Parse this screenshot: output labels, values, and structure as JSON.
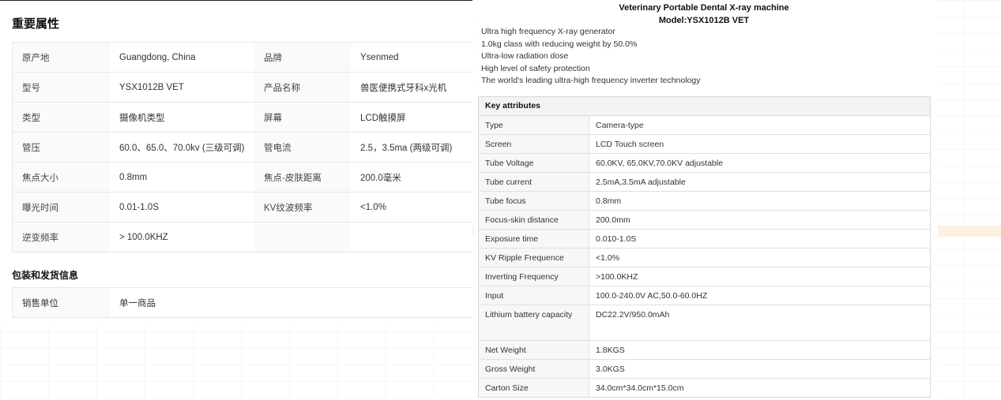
{
  "left": {
    "title": "重要属性",
    "attributes": [
      [
        "原产地",
        "Guangdong, China",
        "品牌",
        "Ysenmed"
      ],
      [
        "型号",
        "YSX1012B VET",
        "产品名称",
        "兽医便携式牙科x光机"
      ],
      [
        "类型",
        "摄像机类型",
        "屏幕",
        "LCD触摸屏"
      ],
      [
        "管压",
        "60.0、65.0、70.0kv (三级可调)",
        "管电流",
        "2.5，3.5ma (两级可调)"
      ],
      [
        "焦点大小",
        "0.8mm",
        "焦点-皮肤距离",
        "200.0毫米"
      ],
      [
        "曝光时间",
        "0.01-1.0S",
        "KV纹波频率",
        "<1.0%"
      ],
      [
        "逆变频率",
        "> 100.0KHZ",
        "",
        ""
      ]
    ],
    "packaging_title": "包装和发货信息",
    "packaging": [
      [
        "销售单位",
        "单一商品"
      ]
    ]
  },
  "right": {
    "title_line1": "Veterinary Portable Dental X-ray machine",
    "title_line2": "Model:YSX1012B VET",
    "features": [
      "Ultra high frequency X-ray generator",
      "1.0kg class with reducing weight by 50.0%",
      "Ultra-low radiation dose",
      "High level of safety protection",
      "The world's leading ultra-high frequency inverter technology"
    ],
    "spec_header": "Key attributes",
    "specs": [
      [
        "Type",
        "Camera-type"
      ],
      [
        "Screen",
        "LCD Touch screen"
      ],
      [
        "Tube Voltage",
        "60.0KV, 65.0KV,70.0KV adjustable"
      ],
      [
        "Tube current",
        "2.5mA,3.5mA adjustable"
      ],
      [
        "Tube focus",
        "0.8mm"
      ],
      [
        "Focus-skin distance",
        "200.0mm"
      ],
      [
        "Exposure time",
        "0.010-1.0S"
      ],
      [
        "KV Ripple Frequence",
        "<1.0%"
      ],
      [
        "Inverting Frequency",
        ">100.0KHZ"
      ],
      [
        "Input",
        "100.0-240.0V AC,50.0-60.0HZ"
      ],
      [
        "Lithium battery capacity",
        "DC22.2V/950.0mAh"
      ],
      [
        "Net Weight",
        "1.8KGS"
      ],
      [
        "Gross Weight",
        "3.0KGS"
      ],
      [
        "Carton Size",
        "34.0cm*34.0cm*15.0cm"
      ]
    ]
  }
}
